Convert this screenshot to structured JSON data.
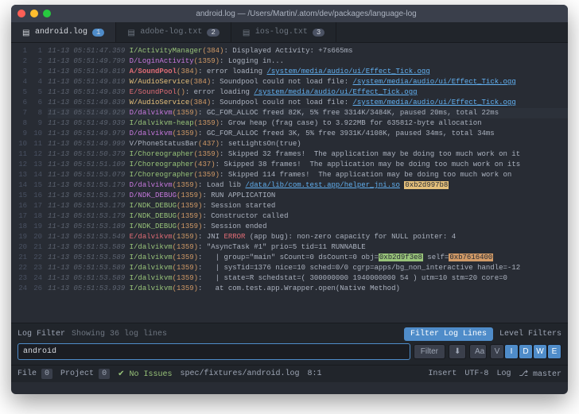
{
  "window": {
    "title": "android.log — /Users/Martin/.atom/dev/packages/language-log"
  },
  "tabs": [
    {
      "name": "android.log",
      "badge": "1",
      "active": true
    },
    {
      "name": "adobe-log.txt",
      "badge": "2",
      "active": false
    },
    {
      "name": "ios-log.txt",
      "badge": "3",
      "active": false
    }
  ],
  "lines": [
    {
      "n": 1,
      "ts": "11-13 05:51:47.359",
      "lvl": "I",
      "tag": "ActivityManager",
      "pid": "384",
      "msg": "Displayed Activity: +7s665ms"
    },
    {
      "n": 2,
      "ts": "11-13 05:51:49.799",
      "lvl": "D",
      "tag": "LoginActivity",
      "pid": "1359",
      "msg": "Logging in..."
    },
    {
      "n": 3,
      "ts": "11-13 05:51:49.819",
      "lvl": "A",
      "tag": "SoundPool",
      "pid": "384",
      "msg": "error loading ",
      "path": "/system/media/audio/ui/Effect_Tick.ogg"
    },
    {
      "n": 4,
      "ts": "11-13 05:51:49.819",
      "lvl": "W",
      "tag": "AudioService",
      "pid": "384",
      "msg": "Soundpool could not load file: ",
      "path": "/system/media/audio/ui/Effect_Tick.ogg"
    },
    {
      "n": 5,
      "ts": "11-13 05:51:49.839",
      "lvl": "E",
      "tag": "SoundPool",
      "pid": "",
      "msg": "error loading ",
      "path": "/system/media/audio/ui/Effect_Tick.ogg"
    },
    {
      "n": 6,
      "ts": "11-13 05:51:49.839",
      "lvl": "W",
      "tag": "AudioService",
      "pid": "384",
      "msg": "Soundpool could not load file: ",
      "path": "/system/media/audio/ui/Effect_Tick.ogg"
    },
    {
      "n": 8,
      "ts": "11-13 05:51:49.929",
      "lvl": "D",
      "tag": "dalvikvm",
      "pid": "1359",
      "msg": "GC_FOR_ALLOC freed 82K, 5% free 3314K/3484K, paused 20ms, total 22ms",
      "hl": true
    },
    {
      "n": 9,
      "ts": "11-13 05:51:49.939",
      "lvl": "I",
      "tag": "dalvikvm-heap",
      "pid": "1359",
      "msg": "Grow heap (frag case) to 3.922MB for 635812-byte allocation"
    },
    {
      "n": 10,
      "ts": "11-13 05:51:49.979",
      "lvl": "D",
      "tag": "dalvikvm",
      "pid": "1359",
      "msg": "GC_FOR_ALLOC freed 3K, 5% free 3931K/4108K, paused 34ms, total 34ms"
    },
    {
      "n": 11,
      "ts": "11-13 05:51:49.999",
      "lvl": "V",
      "tag": "PhoneStatusBar",
      "pid": "437",
      "msg": "setLightsOn(true)"
    },
    {
      "n": 12,
      "ts": "11-13 05:51:50.379",
      "lvl": "I",
      "tag": "Choreographer",
      "pid": "1359",
      "msg": "Skipped 32 frames!  The application may be doing too much work on it"
    },
    {
      "n": 13,
      "ts": "11-13 05:51:51.109",
      "lvl": "I",
      "tag": "Choreographer",
      "pid": "437",
      "msg": "Skipped 38 frames!  The application may be doing too much work on its"
    },
    {
      "n": 14,
      "ts": "11-13 05:51:53.079",
      "lvl": "I",
      "tag": "Choreographer",
      "pid": "1359",
      "msg": "Skipped 114 frames!  The application may be doing too much work on "
    },
    {
      "n": 15,
      "ts": "11-13 05:51:53.179",
      "lvl": "D",
      "tag": "dalvikvm",
      "pid": "1359",
      "msg": "Load lib ",
      "path": "/data/lib/com.test.app/helper_jni.so",
      "hex": "0xb2d997b8"
    },
    {
      "n": 16,
      "ts": "11-13 05:51:53.179",
      "lvl": "D",
      "tag": "NDK_DEBUG",
      "pid": "1359",
      "msg": "RUN APPLICATION"
    },
    {
      "n": 17,
      "ts": "11-13 05:51:53.179",
      "lvl": "I",
      "tag": "NDK_DEBUG",
      "pid": "1359",
      "msg": "Session started"
    },
    {
      "n": 18,
      "ts": "11-13 05:51:53.179",
      "lvl": "I",
      "tag": "NDK_DEBUG",
      "pid": "1359",
      "msg": "Constructor called"
    },
    {
      "n": 19,
      "ts": "11-13 05:51:53.189",
      "lvl": "I",
      "tag": "NDK_DEBUG",
      "pid": "1359",
      "msg": "Session ended"
    },
    {
      "n": 20,
      "ts": "11-13 05:51:53.549",
      "lvl": "E",
      "tag": "dalvikvm",
      "pid": "1359",
      "msg_pre": "JNI ",
      "err": "ERROR",
      "msg": " (app bug): non-zero capacity for NULL pointer: 4"
    },
    {
      "n": 21,
      "ts": "11-13 05:51:53.589",
      "lvl": "I",
      "tag": "dalvikvm",
      "pid": "1359",
      "msg": "\"AsyncTask #1\" prio=5 tid=11 RUNNABLE"
    },
    {
      "n": 22,
      "ts": "11-13 05:51:53.589",
      "lvl": "I",
      "tag": "dalvikvm",
      "pid": "1359",
      "msg": "  | group=\"main\" sCount=0 dsCount=0 obj=",
      "hex2": "0xb2d9f3e8",
      "mid": " self=",
      "hex3": "0xb7616400"
    },
    {
      "n": 23,
      "ts": "11-13 05:51:53.589",
      "lvl": "I",
      "tag": "dalvikvm",
      "pid": "1359",
      "msg": "  | sysTid=1376 nice=10 sched=0/0 cgrp=apps/bg_non_interactive handle=-12"
    },
    {
      "n": 24,
      "ts": "11-13 05:51:53.589",
      "lvl": "I",
      "tag": "dalvikvm",
      "pid": "1359",
      "msg": "  | state=R schedstat=( 300000000 1940000000 54 ) utm=10 stm=20 core=0"
    },
    {
      "n": 26,
      "ts": "11-13 05:51:53.939",
      "lvl": "I",
      "tag": "dalvikvm",
      "pid": "1359",
      "msg": "  at com.test.app.Wrapper.open(Native Method)"
    }
  ],
  "filter": {
    "title": "Log Filter",
    "showing": "Showing 36 log lines",
    "tooltip": "Filter Log Lines",
    "levels_label": "Level Filters",
    "input_value": "android",
    "btn_filter": "Filter",
    "btn_aa": "Aa",
    "levels": [
      "V",
      "I",
      "D",
      "W",
      "E"
    ]
  },
  "statusbar": {
    "file": "File",
    "file_n": "0",
    "project": "Project",
    "project_n": "0",
    "issues": "No Issues",
    "path": "spec/fixtures/android.log",
    "cursor": "8:1",
    "insert": "Insert",
    "encoding": "UTF-8",
    "grammar": "Log",
    "branch": "master"
  }
}
